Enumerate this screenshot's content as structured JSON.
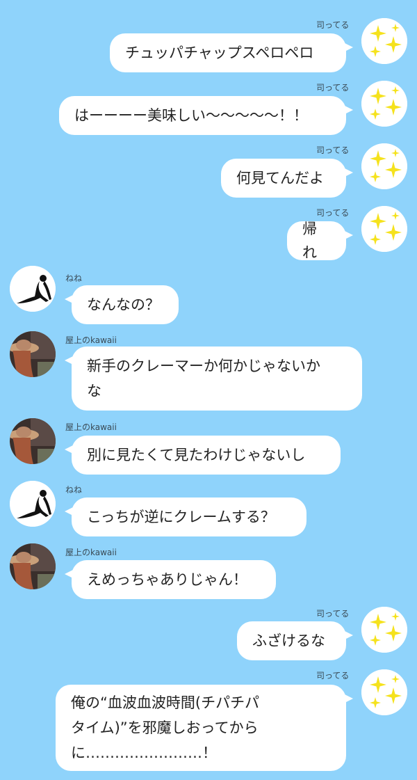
{
  "colors": {
    "background": "#8fd3fb",
    "bubble": "#ffffff",
    "sparkle": "#f5e21c"
  },
  "users": {
    "tsukasa": {
      "name": "司ってる",
      "avatar_icon": "sparkle-stars-icon"
    },
    "nene": {
      "name": "ねね",
      "avatar_icon": "silhouette-woman-icon"
    },
    "okujo": {
      "name": "屋上のkawaii",
      "avatar_icon": "photo-girl-hat-icon"
    }
  },
  "messages": [
    {
      "sender": "司ってる",
      "text": "チュッパチャップスペロペロ",
      "side": "right"
    },
    {
      "sender": "司ってる",
      "text": "はーーーー美味しい〜〜〜〜〜！！",
      "side": "right"
    },
    {
      "sender": "司ってる",
      "text": "何見てんだよ",
      "side": "right"
    },
    {
      "sender": "司ってる",
      "text": "帰れ",
      "side": "right"
    },
    {
      "sender": "ねね",
      "text": "なんなの？",
      "side": "left"
    },
    {
      "sender": "屋上のkawaii",
      "text": "新手のクレーマーか何かじゃないか\nな",
      "side": "left"
    },
    {
      "sender": "屋上のkawaii",
      "text": "別に見たくて見たわけじゃないし",
      "side": "left"
    },
    {
      "sender": "ねね",
      "text": "こっちが逆にクレームする？",
      "side": "left"
    },
    {
      "sender": "屋上のkawaii",
      "text": "えめっちゃありじゃん！",
      "side": "left"
    },
    {
      "sender": "司ってる",
      "text": "ふざけるな",
      "side": "right"
    },
    {
      "sender": "司ってる",
      "text": "俺の“血波血波時間(チパチパ\nタイム)”を邪魔しおってから\nに……………………！",
      "side": "right"
    }
  ]
}
